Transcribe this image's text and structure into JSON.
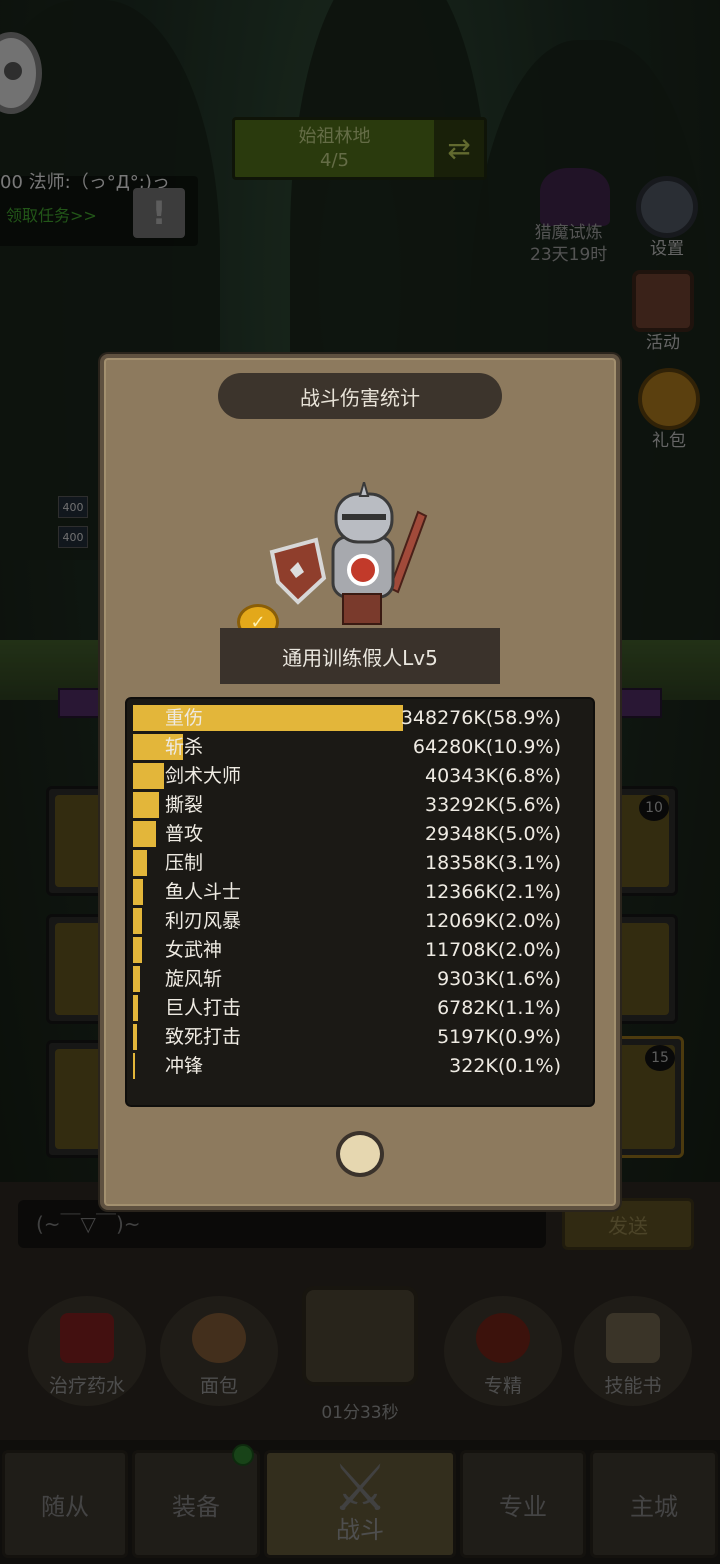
{
  "top": {
    "stage_name": "始祖林地",
    "stage_progress": "4/5",
    "quest_title": "00 法师:（っ°Д°;)っ",
    "quest_link": "领取任务>>",
    "quest_alert": "!",
    "demon_trial": "猎魔试炼",
    "demon_trial_time": "23天19时",
    "settings_label": "设置",
    "activity_label": "活动",
    "gift_label": "礼包",
    "hp_tag_1": "400",
    "hp_tag_2": "400"
  },
  "panel": {
    "title": "战斗伤害统计",
    "target": "通用训练假人Lv5"
  },
  "chart_data": {
    "type": "bar",
    "title": "战斗伤害统计",
    "categories": [
      "重伤",
      "斩杀",
      "剑术大师",
      "撕裂",
      "普攻",
      "压制",
      "鱼人斗士",
      "利刃风暴",
      "女武神",
      "旋风斩",
      "巨人打击",
      "致死打击",
      "冲锋"
    ],
    "value_labels": [
      "348276K(58.9%)",
      "64280K(10.9%)",
      "40343K(6.8%)",
      "33292K(5.6%)",
      "29348K(5.0%)",
      "18358K(3.1%)",
      "12366K(2.1%)",
      "12069K(2.0%)",
      "11708K(2.0%)",
      "9303K(1.6%)",
      "6782K(1.1%)",
      "5197K(0.9%)",
      "322K(0.1%)"
    ],
    "values": [
      348276,
      64280,
      40343,
      33292,
      29348,
      18358,
      12366,
      12069,
      11708,
      9303,
      6782,
      5197,
      322
    ],
    "bar_color": "#e3b63a"
  },
  "slots": {
    "count_top_right": "10",
    "count_bottom_right": "15"
  },
  "chat": {
    "placeholder": "(~￣▽￣)~",
    "send_label": "发送"
  },
  "actions": {
    "potion": "治疗药水",
    "bread": "面包",
    "chest_timer": "01分33秒",
    "specialty": "专精",
    "skill_book": "技能书"
  },
  "nav": {
    "followers": "随从",
    "equipment": "装备",
    "battle": "战斗",
    "profession": "专业",
    "main_city": "主城"
  }
}
